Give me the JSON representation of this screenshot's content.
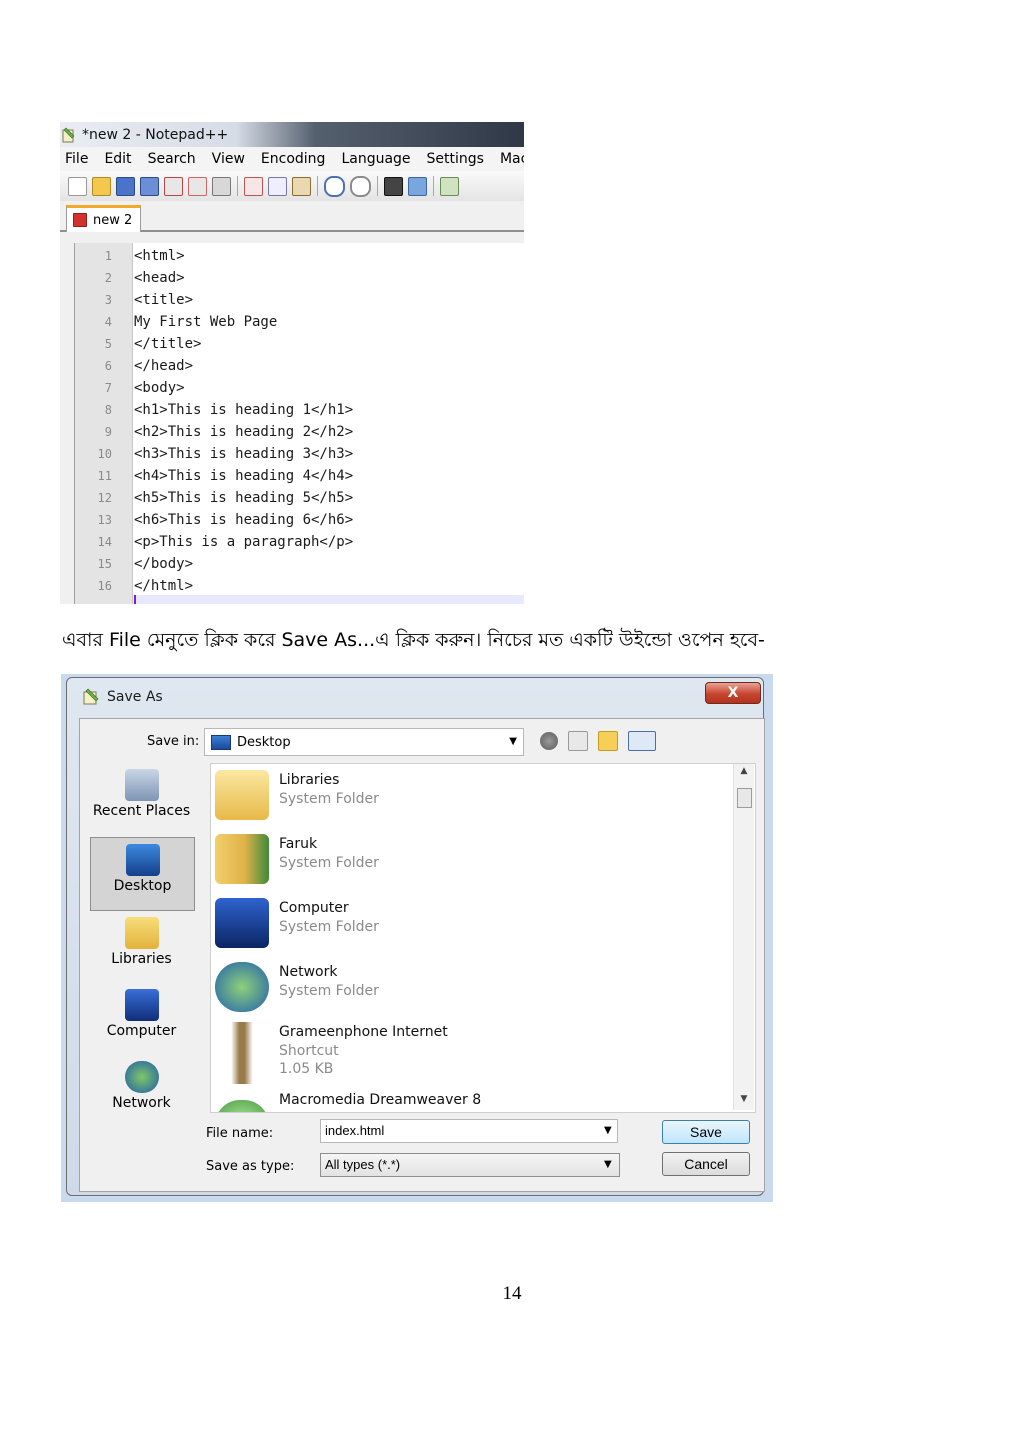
{
  "notepad": {
    "title": "*new 2 - Notepad++",
    "menu": [
      "File",
      "Edit",
      "Search",
      "View",
      "Encoding",
      "Language",
      "Settings",
      "Macro"
    ],
    "tab": "new 2",
    "code_lines": [
      "<html>",
      "<head>",
      "<title>",
      "My First Web Page",
      "</title>",
      "</head>",
      "<body>",
      "<h1>This is heading 1</h1>",
      "<h2>This is heading 2</h2>",
      "<h3>This is heading 3</h3>",
      "<h4>This is heading 4</h4>",
      "<h5>This is heading 5</h5>",
      "<h6>This is heading 6</h6>",
      "<p>This is a paragraph</p>",
      "</body>",
      "</html>"
    ]
  },
  "instruction": "এবার File মেনুতে ক্লিক করে Save As...এ ক্লিক করুন। নিচের মত একটি উইন্ডো ওপেন হবে-",
  "dialog": {
    "title": "Save As",
    "close_label": "X",
    "save_in_label": "Save in:",
    "save_in_value": "Desktop",
    "places": [
      "Recent Places",
      "Desktop",
      "Libraries",
      "Computer",
      "Network"
    ],
    "files": [
      {
        "name": "Libraries",
        "type": "System Folder",
        "size": ""
      },
      {
        "name": "Faruk",
        "type": "System Folder",
        "size": ""
      },
      {
        "name": "Computer",
        "type": "System Folder",
        "size": ""
      },
      {
        "name": "Network",
        "type": "System Folder",
        "size": ""
      },
      {
        "name": "Grameenphone Internet",
        "type": "Shortcut",
        "size": "1.05 KB"
      },
      {
        "name": "Macromedia Dreamweaver 8",
        "type": "",
        "size": ""
      }
    ],
    "file_name_label": "File name:",
    "file_name_value": "index.html",
    "save_as_type_label": "Save as type:",
    "save_as_type_value": "All types (*.*)",
    "save_button": "Save",
    "cancel_button": "Cancel"
  },
  "page_number": "14",
  "colors": {
    "tab_accent": "#f6a828",
    "close_button": "#c7452f",
    "save_button_border": "#3c7fb1"
  }
}
